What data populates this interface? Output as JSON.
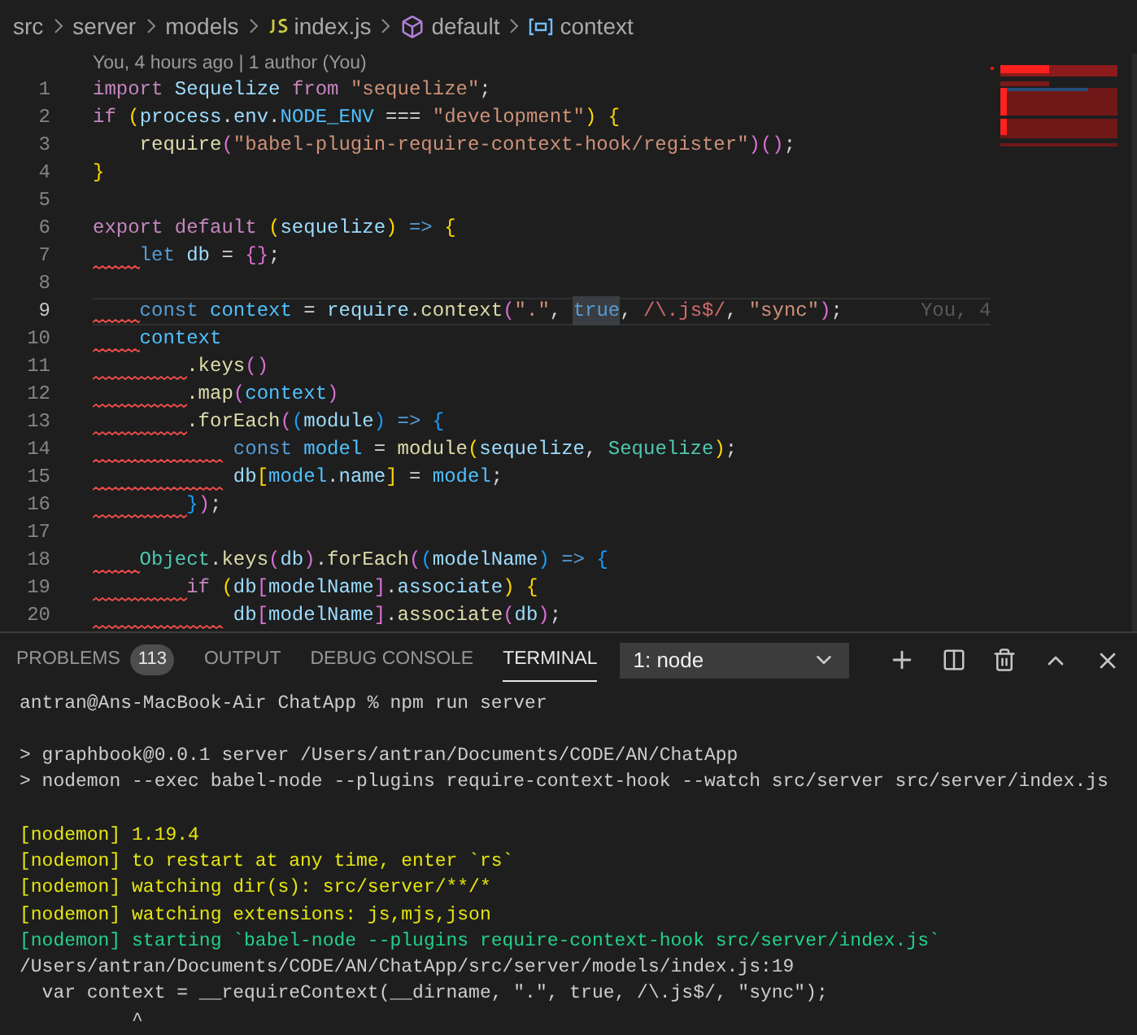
{
  "breadcrumb": [
    {
      "text": "src",
      "kind": "folder"
    },
    {
      "text": "server",
      "kind": "folder"
    },
    {
      "text": "models",
      "kind": "folder"
    },
    {
      "text": "index.js",
      "kind": "js"
    },
    {
      "text": "default",
      "kind": "module"
    },
    {
      "text": "context",
      "kind": "variable"
    }
  ],
  "codelens": "You, 4 hours ago | 1 author (You)",
  "editor": {
    "lines": [
      {
        "number": "1",
        "current": false,
        "squiggle": false,
        "tokens": [
          {
            "text": "import ",
            "kind": "keyword"
          },
          {
            "text": "Sequelize ",
            "kind": "variable"
          },
          {
            "text": "from ",
            "kind": "keyword"
          },
          {
            "text": "\"sequelize\"",
            "kind": "string"
          },
          {
            "text": ";",
            "kind": "punct"
          }
        ]
      },
      {
        "number": "2",
        "current": false,
        "squiggle": false,
        "tokens": [
          {
            "text": "if ",
            "kind": "keyword"
          },
          {
            "text": "(",
            "kind": "bracket1"
          },
          {
            "text": "process",
            "kind": "variable"
          },
          {
            "text": ".",
            "kind": "punct"
          },
          {
            "text": "env",
            "kind": "variable"
          },
          {
            "text": ".",
            "kind": "punct"
          },
          {
            "text": "NODE_ENV",
            "kind": "constant"
          },
          {
            "text": " === ",
            "kind": "punct"
          },
          {
            "text": "\"development\"",
            "kind": "string"
          },
          {
            "text": ") {",
            "kind": "bracket1"
          }
        ]
      },
      {
        "number": "3",
        "current": false,
        "squiggle": false,
        "tokens": [
          {
            "text": "    require",
            "kind": "function"
          },
          {
            "text": "(",
            "kind": "bracket2"
          },
          {
            "text": "\"babel-plugin-require-context-hook/register\"",
            "kind": "string"
          },
          {
            "text": ")()",
            "kind": "bracket2"
          },
          {
            "text": ";",
            "kind": "punct"
          }
        ]
      },
      {
        "number": "4",
        "current": false,
        "squiggle": false,
        "tokens": [
          {
            "text": "}",
            "kind": "bracket1"
          }
        ]
      },
      {
        "number": "5",
        "current": false,
        "squiggle": false
      },
      {
        "number": "6",
        "current": false,
        "squiggle": false,
        "tokens": [
          {
            "text": "export default ",
            "kind": "keyword"
          },
          {
            "text": "(",
            "kind": "bracket1"
          },
          {
            "text": "sequelize",
            "kind": "variable"
          },
          {
            "text": ")",
            "kind": "bracket1"
          },
          {
            "text": " => ",
            "kind": "storage"
          },
          {
            "text": "{",
            "kind": "bracket1"
          }
        ]
      },
      {
        "number": "7",
        "current": false,
        "squiggle": true,
        "tokens": [
          {
            "text": "    let ",
            "kind": "storage"
          },
          {
            "text": "db",
            "kind": "variable"
          },
          {
            "text": " = ",
            "kind": "punct"
          },
          {
            "text": "{}",
            "kind": "bracket2"
          },
          {
            "text": ";",
            "kind": "punct"
          }
        ]
      },
      {
        "number": "8",
        "current": false,
        "squiggle": false
      },
      {
        "number": "9",
        "current": true,
        "squiggle": true,
        "blame": "You, 4",
        "tokens": [
          {
            "text": "    const ",
            "kind": "storage"
          },
          {
            "text": "context",
            "kind": "constant"
          },
          {
            "text": " = ",
            "kind": "punct"
          },
          {
            "text": "require",
            "kind": "variable"
          },
          {
            "text": ".",
            "kind": "punct"
          },
          {
            "text": "context",
            "kind": "function"
          },
          {
            "text": "(",
            "kind": "bracket2"
          },
          {
            "text": "\".\"",
            "kind": "string"
          },
          {
            "text": ", ",
            "kind": "punct"
          },
          {
            "text": "true",
            "kind": "match"
          },
          {
            "text": ", ",
            "kind": "punct"
          },
          {
            "text": "/\\.js$/",
            "kind": "regex"
          },
          {
            "text": ", ",
            "kind": "punct"
          },
          {
            "text": "\"sync\"",
            "kind": "string"
          },
          {
            "text": ")",
            "kind": "bracket2"
          },
          {
            "text": ";",
            "kind": "punct"
          }
        ]
      },
      {
        "number": "10",
        "current": false,
        "squiggle": true,
        "tokens": [
          {
            "text": "    context",
            "kind": "constant"
          }
        ]
      },
      {
        "number": "11",
        "current": false,
        "squiggle": true,
        "tokens": [
          {
            "text": "        .keys",
            "kind": "function"
          },
          {
            "text": "()",
            "kind": "bracket2"
          }
        ]
      },
      {
        "number": "12",
        "current": false,
        "squiggle": true,
        "tokens": [
          {
            "text": "        .map",
            "kind": "function"
          },
          {
            "text": "(",
            "kind": "bracket2"
          },
          {
            "text": "context",
            "kind": "constant"
          },
          {
            "text": ")",
            "kind": "bracket2"
          }
        ]
      },
      {
        "number": "13",
        "current": false,
        "squiggle": true,
        "tokens": [
          {
            "text": "        .forEach",
            "kind": "function"
          },
          {
            "text": "(",
            "kind": "bracket2"
          },
          {
            "text": "(",
            "kind": "bracket3"
          },
          {
            "text": "module",
            "kind": "variable"
          },
          {
            "text": ")",
            "kind": "bracket3"
          },
          {
            "text": " => ",
            "kind": "storage"
          },
          {
            "text": "{",
            "kind": "bracket3"
          }
        ]
      },
      {
        "number": "14",
        "current": false,
        "squiggle": true,
        "tokens": [
          {
            "text": "            const ",
            "kind": "storage"
          },
          {
            "text": "model",
            "kind": "constant"
          },
          {
            "text": " = ",
            "kind": "punct"
          },
          {
            "text": "module",
            "kind": "function"
          },
          {
            "text": "(",
            "kind": "bracket1"
          },
          {
            "text": "sequelize",
            "kind": "variable"
          },
          {
            "text": ", ",
            "kind": "punct"
          },
          {
            "text": "Sequelize",
            "kind": "class"
          },
          {
            "text": ")",
            "kind": "bracket1"
          },
          {
            "text": ";",
            "kind": "punct"
          }
        ]
      },
      {
        "number": "15",
        "current": false,
        "squiggle": true,
        "tokens": [
          {
            "text": "            db",
            "kind": "variable"
          },
          {
            "text": "[",
            "kind": "bracket1"
          },
          {
            "text": "model",
            "kind": "constant"
          },
          {
            "text": ".",
            "kind": "punct"
          },
          {
            "text": "name",
            "kind": "variable"
          },
          {
            "text": "]",
            "kind": "bracket1"
          },
          {
            "text": " = ",
            "kind": "punct"
          },
          {
            "text": "model",
            "kind": "constant"
          },
          {
            "text": ";",
            "kind": "punct"
          }
        ]
      },
      {
        "number": "16",
        "current": false,
        "squiggle": true,
        "tokens": [
          {
            "text": "        }",
            "kind": "bracket3"
          },
          {
            "text": ")",
            "kind": "bracket2"
          },
          {
            "text": ";",
            "kind": "punct"
          }
        ]
      },
      {
        "number": "17",
        "current": false,
        "squiggle": false
      },
      {
        "number": "18",
        "current": false,
        "squiggle": true,
        "tokens": [
          {
            "text": "    Object",
            "kind": "class"
          },
          {
            "text": ".",
            "kind": "punct"
          },
          {
            "text": "keys",
            "kind": "function"
          },
          {
            "text": "(",
            "kind": "bracket2"
          },
          {
            "text": "db",
            "kind": "variable"
          },
          {
            "text": ")",
            "kind": "bracket2"
          },
          {
            "text": ".",
            "kind": "punct"
          },
          {
            "text": "forEach",
            "kind": "function"
          },
          {
            "text": "(",
            "kind": "bracket2"
          },
          {
            "text": "(",
            "kind": "bracket3"
          },
          {
            "text": "modelName",
            "kind": "variable"
          },
          {
            "text": ")",
            "kind": "bracket3"
          },
          {
            "text": " => ",
            "kind": "storage"
          },
          {
            "text": "{",
            "kind": "bracket3"
          }
        ]
      },
      {
        "number": "19",
        "current": false,
        "squiggle": true,
        "tokens": [
          {
            "text": "        if ",
            "kind": "keyword"
          },
          {
            "text": "(",
            "kind": "bracket1"
          },
          {
            "text": "db",
            "kind": "variable"
          },
          {
            "text": "[",
            "kind": "bracket2"
          },
          {
            "text": "modelName",
            "kind": "variable"
          },
          {
            "text": "]",
            "kind": "bracket2"
          },
          {
            "text": ".",
            "kind": "punct"
          },
          {
            "text": "associate",
            "kind": "variable"
          },
          {
            "text": ")",
            "kind": "bracket1"
          },
          {
            "text": " {",
            "kind": "bracket1"
          }
        ]
      },
      {
        "number": "20",
        "current": false,
        "squiggle": true,
        "tokens": [
          {
            "text": "            db",
            "kind": "variable"
          },
          {
            "text": "[",
            "kind": "bracket2"
          },
          {
            "text": "modelName",
            "kind": "variable"
          },
          {
            "text": "]",
            "kind": "bracket2"
          },
          {
            "text": ".",
            "kind": "punct"
          },
          {
            "text": "associate",
            "kind": "function"
          },
          {
            "text": "(",
            "kind": "bracket2"
          },
          {
            "text": "db",
            "kind": "variable"
          },
          {
            "text": ")",
            "kind": "bracket2"
          },
          {
            "text": ";",
            "kind": "punct"
          }
        ]
      }
    ]
  },
  "panel": {
    "tabs": [
      {
        "label": "PROBLEMS",
        "badge": "113",
        "selected": false
      },
      {
        "label": "OUTPUT",
        "selected": false
      },
      {
        "label": "DEBUG CONSOLE",
        "selected": false
      },
      {
        "label": "TERMINAL",
        "selected": true
      }
    ],
    "terminal_select": "1: node",
    "terminal": [
      [
        {
          "text": "antran@Ans-MacBook-Air ChatApp % npm run server",
          "kind": "plain"
        }
      ],
      [
        {
          "text": "> graphbook@0.0.1 server /Users/antran/Documents/CODE/AN/ChatApp",
          "kind": "plain"
        },
        {
          "text": "> nodemon --exec babel-node --plugins require-context-hook --watch src/server src/server/index.js",
          "kind": "plain"
        }
      ],
      [
        {
          "text": "[nodemon] 1.19.4",
          "kind": "warn"
        },
        {
          "text": "[nodemon] to restart at any time, enter `rs`",
          "kind": "warn"
        },
        {
          "text": "[nodemon] watching dir(s): src/server/**/*",
          "kind": "warn"
        },
        {
          "text": "[nodemon] watching extensions: js,mjs,json",
          "kind": "warn"
        },
        {
          "text": "[nodemon] starting `babel-node --plugins require-context-hook src/server/index.js`",
          "kind": "ok"
        },
        {
          "text": "/Users/antran/Documents/CODE/AN/ChatApp/src/server/models/index.js:19",
          "kind": "plain"
        },
        {
          "text": "  var context = __requireContext(__dirname, \".\", true, /\\.js$/, \"sync\");",
          "kind": "plain"
        },
        {
          "text": "          ^",
          "kind": "plain"
        }
      ]
    ]
  }
}
